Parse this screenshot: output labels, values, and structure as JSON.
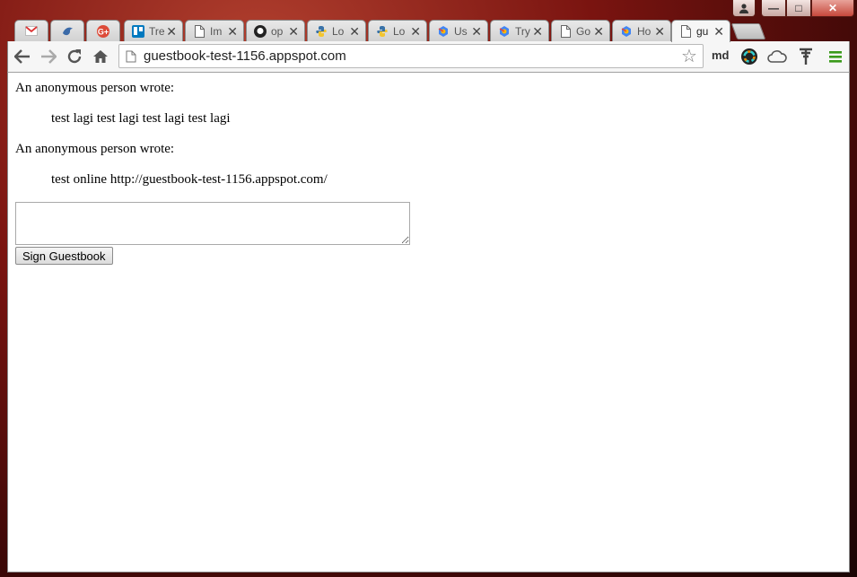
{
  "browser": {
    "tabs": [
      {
        "title": "",
        "icon": "gmail-icon",
        "pinned": true
      },
      {
        "title": "",
        "icon": "bird-icon",
        "pinned": true
      },
      {
        "title": "",
        "icon": "google-plus-icon",
        "pinned": true
      },
      {
        "title": "Tre",
        "icon": "trello-icon"
      },
      {
        "title": "Im",
        "icon": "page-icon"
      },
      {
        "title": "op",
        "icon": "github-icon"
      },
      {
        "title": "Lo",
        "icon": "python-icon"
      },
      {
        "title": "Lo",
        "icon": "python-icon"
      },
      {
        "title": "Us",
        "icon": "appengine-icon"
      },
      {
        "title": "Try",
        "icon": "appengine-icon"
      },
      {
        "title": "Go",
        "icon": "page-icon"
      },
      {
        "title": "Ho",
        "icon": "appengine-icon"
      },
      {
        "title": "gu",
        "icon": "page-icon",
        "active": true
      }
    ],
    "address": "guestbook-test-1156.appspot.com",
    "extension_label": "md"
  },
  "page": {
    "entries": [
      {
        "author": "An anonymous person wrote:",
        "content": "test lagi test lagi test lagi test lagi"
      },
      {
        "author": "An anonymous person wrote:",
        "content": "test online http://guestbook-test-1156.appspot.com/"
      }
    ],
    "textarea_value": "",
    "submit_label": "Sign Guestbook"
  },
  "colors": {
    "desktop_bg": "#7a1410",
    "menu_green": "#3a9a1a",
    "gplus_red": "#dd4b39",
    "trello_blue": "#0079bf"
  }
}
